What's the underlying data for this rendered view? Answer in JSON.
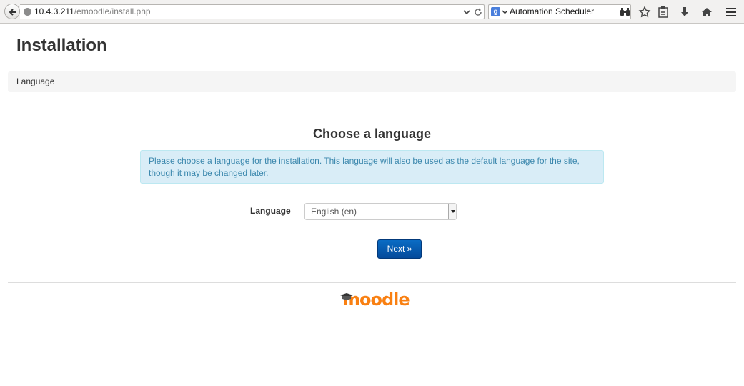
{
  "browser": {
    "url_host": "10.4.3.211",
    "url_path": "/emoodle/install.php",
    "search_engine_icon": "google-icon",
    "search_text": "Automation Scheduler",
    "toolbar_icons": [
      "back-arrow-icon",
      "globe-icon",
      "chevron-down-icon",
      "reload-icon",
      "binoculars-icon",
      "star-icon",
      "clipboard-icon",
      "download-icon",
      "home-icon",
      "menu-icon"
    ]
  },
  "page": {
    "title": "Installation",
    "breadcrumb": "Language",
    "heading": "Choose a language",
    "info_text": "Please choose a language for the installation. This language will also be used as the default language for the site, though it may be changed later.",
    "language_label": "Language",
    "language_selected": "English (en)",
    "next_button": "Next »",
    "logo_text": "moodle"
  },
  "colors": {
    "accent": "#044a9b",
    "info_bg": "#d9edf7",
    "info_text": "#3a87ad",
    "logo": "#f98012"
  }
}
